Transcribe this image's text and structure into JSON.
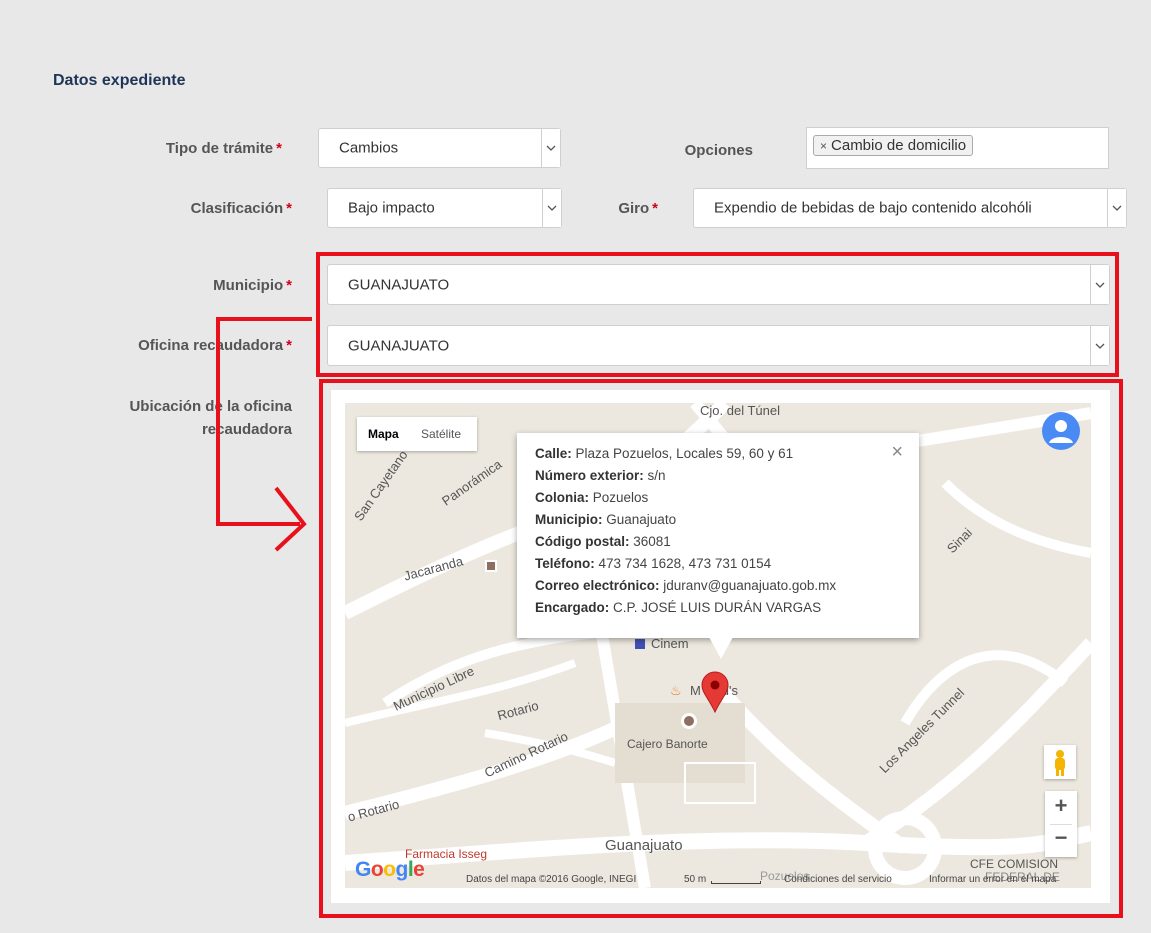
{
  "section_title": "Datos expediente",
  "required_mark": "*",
  "form": {
    "tipo_tramite": {
      "label": "Tipo de trámite",
      "value": "Cambios"
    },
    "opciones": {
      "label": "Opciones",
      "tag": "Cambio de domicilio",
      "tag_remove": "×"
    },
    "clasificacion": {
      "label": "Clasificación",
      "value": "Bajo impacto"
    },
    "giro": {
      "label": "Giro",
      "value": "Expendio de bebidas de bajo contenido alcohóli"
    },
    "municipio": {
      "label": "Municipio",
      "value": "GUANAJUATO"
    },
    "oficina": {
      "label": "Oficina recaudadora",
      "value": "GUANAJUATO"
    },
    "ubicacion": {
      "label_line1": "Ubicación de la oficina",
      "label_line2": "recaudadora"
    }
  },
  "dropdown_icon": "chevron-down-icon",
  "map": {
    "type_buttons": [
      "Mapa",
      "Satélite"
    ],
    "close": "×",
    "popup": [
      {
        "key": "Calle:",
        "value": "Plaza Pozuelos, Locales 59, 60 y 61"
      },
      {
        "key": "Número exterior:",
        "value": "s/n"
      },
      {
        "key": "Colonia:",
        "value": "Pozuelos"
      },
      {
        "key": "Municipio:",
        "value": "Guanajuato"
      },
      {
        "key": "Código postal:",
        "value": "36081"
      },
      {
        "key": "Teléfono:",
        "value": "473 734 1628, 473 731 0154"
      },
      {
        "key": "Correo electrónico:",
        "value": "jduranv@guanajuato.gob.mx"
      },
      {
        "key": "Encargado:",
        "value": "C.P. JOSÉ LUIS DURÁN VARGAS"
      }
    ],
    "labels": {
      "tunel": "Cjo. del Túnel",
      "san_cayetano": "San Cayetano San",
      "panoramica": "Panorámica",
      "jacaranda": "Jacaranda",
      "municipio_libre": "Municipio Libre",
      "rotario": "Rotario",
      "camino_rotario": "Camino Rotario",
      "rotario_left": "o Rotario",
      "los_angeles": "Los Angeles Tunnel",
      "sinai": "Sinai",
      "cinem": "Cinem",
      "mcdonalds": "M    nald's",
      "cajero": "Cajero Banorte",
      "farmacia": "Farmacia Isseg",
      "guanajuato": "Guanajuato",
      "cfe": "CFE COMISION",
      "federal": "FEDERAL DE",
      "pozuelos": "Pozuelos"
    },
    "google": "Google",
    "attribution": "Datos del mapa ©2016 Google, INEGI",
    "scale": "50 m",
    "terms": "Condiciones del servicio",
    "report": "Informar un error en el mapa",
    "zoom_in": "+",
    "zoom_out": "−"
  },
  "colors": {
    "annotation_red": "#e8101a",
    "title_blue": "#1d3557",
    "marker_red": "#e53935"
  }
}
